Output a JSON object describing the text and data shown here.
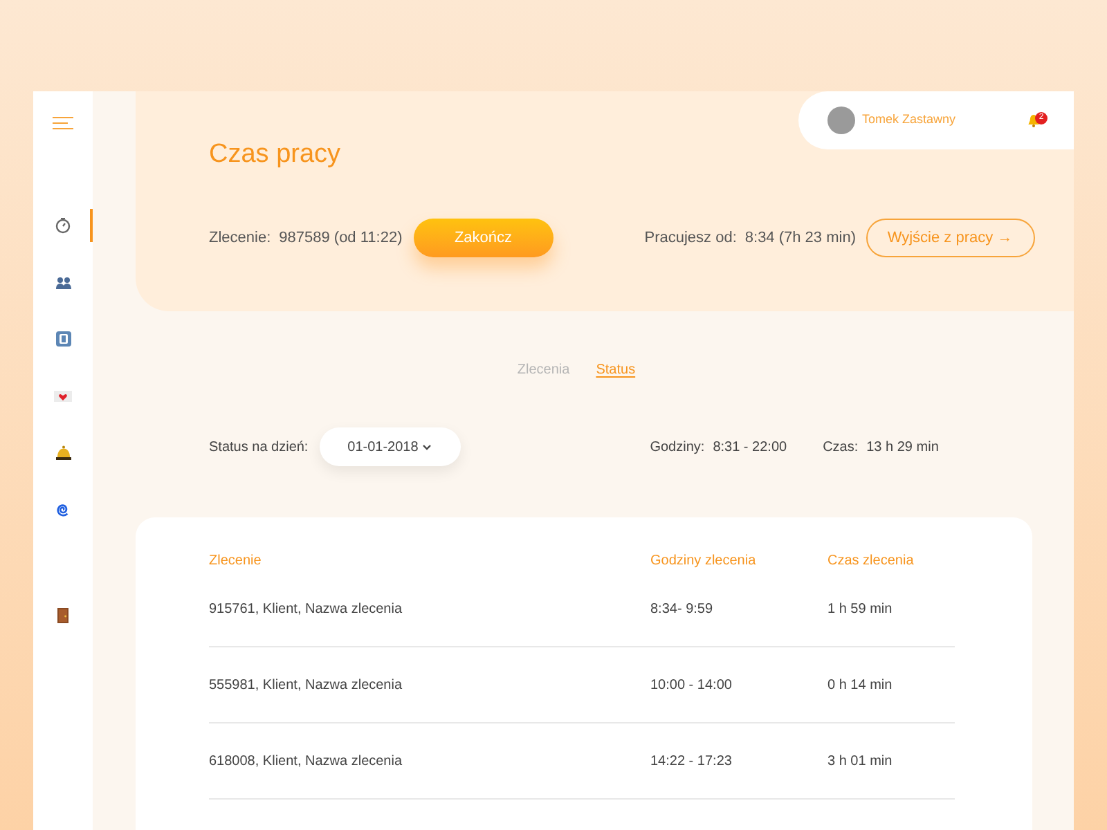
{
  "sidebar": {
    "items": [
      {
        "kind": "stopwatch",
        "selected": true
      },
      {
        "kind": "people",
        "selected": false
      },
      {
        "kind": "badge",
        "selected": false
      },
      {
        "kind": "letter",
        "selected": false
      },
      {
        "kind": "bell",
        "selected": false
      },
      {
        "kind": "spiral",
        "selected": false
      },
      {
        "kind": "door",
        "selected": false
      }
    ]
  },
  "user": {
    "name": "Tomek Zastawny",
    "notifications": "2"
  },
  "title": "Czas pracy",
  "current": {
    "order_label": "Zlecenie:",
    "order_value": "987589 (od 11:22)",
    "finish_button": "Zakończ",
    "since_label": "Pracujesz od:",
    "since_value": "8:34 (7h 23 min)",
    "exit_button": "Wyjście z pracy →"
  },
  "tabs": [
    {
      "label": "Zlecenia",
      "selected": false
    },
    {
      "label": "Status",
      "selected": true
    }
  ],
  "status": {
    "date_label": "Status na dzień:",
    "date": "01-01-2018",
    "hours_label": "Godziny:",
    "hours_value": "8:31 - 22:00",
    "time_label": "Czas:",
    "time_value": "13 h 29 min"
  },
  "table": {
    "columns": [
      "Zlecenie",
      "Godziny zlecenia",
      "Czas zlecenia"
    ],
    "rows": [
      [
        "915761, Klient, Nazwa zlecenia",
        "8:34- 9:59",
        "1 h 59 min"
      ],
      [
        "555981, Klient, Nazwa zlecenia",
        "10:00 - 14:00",
        "0 h 14 min"
      ],
      [
        "618008, Klient, Nazwa zlecenia",
        "14:22 - 17:23",
        "3 h 01 min"
      ]
    ]
  }
}
